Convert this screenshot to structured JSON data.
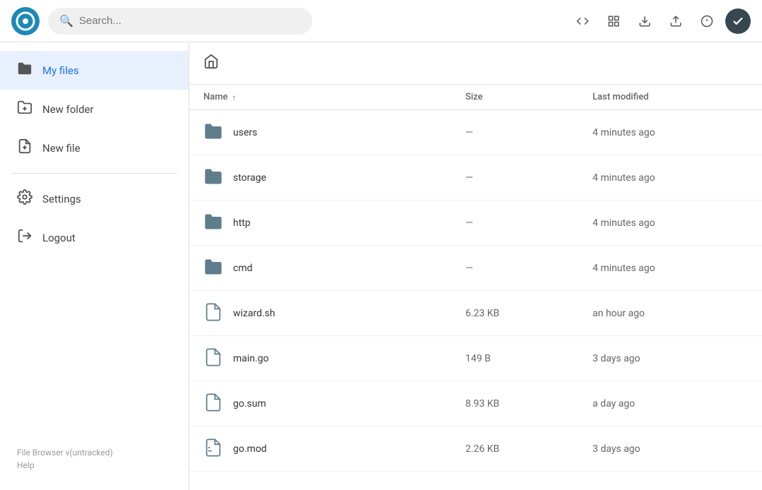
{
  "header": {
    "logo_alt": "File Browser Logo",
    "search_placeholder": "Search...",
    "actions": [
      {
        "name": "code-icon",
        "symbol": "<>",
        "label": "Code view",
        "active": false
      },
      {
        "name": "grid-icon",
        "symbol": "⊞",
        "label": "Grid view",
        "active": false
      },
      {
        "name": "download-icon",
        "symbol": "↓",
        "label": "Download",
        "active": false
      },
      {
        "name": "upload-icon",
        "symbol": "↑",
        "label": "Upload",
        "active": false
      },
      {
        "name": "info-icon",
        "symbol": "ℹ",
        "label": "Info",
        "active": false
      },
      {
        "name": "check-icon",
        "symbol": "✓",
        "label": "Select all",
        "active": true
      }
    ]
  },
  "sidebar": {
    "items": [
      {
        "id": "my-files",
        "label": "My files",
        "icon": "folder",
        "active": true
      },
      {
        "id": "new-folder",
        "label": "New folder",
        "icon": "new-folder",
        "active": false
      },
      {
        "id": "new-file",
        "label": "New file",
        "icon": "new-file",
        "active": false
      },
      {
        "id": "settings",
        "label": "Settings",
        "icon": "settings",
        "active": false
      },
      {
        "id": "logout",
        "label": "Logout",
        "icon": "logout",
        "active": false
      }
    ],
    "footer": {
      "version": "File Browser v(untracked)",
      "help": "Help"
    }
  },
  "file_list": {
    "columns": {
      "name": "Name",
      "size": "Size",
      "last_modified": "Last modified"
    },
    "rows": [
      {
        "id": "users",
        "name": "users",
        "type": "folder",
        "size": "—",
        "modified": "4 minutes ago"
      },
      {
        "id": "storage",
        "name": "storage",
        "type": "folder",
        "size": "—",
        "modified": "4 minutes ago"
      },
      {
        "id": "http",
        "name": "http",
        "type": "folder",
        "size": "—",
        "modified": "4 minutes ago"
      },
      {
        "id": "cmd",
        "name": "cmd",
        "type": "folder",
        "size": "—",
        "modified": "4 minutes ago"
      },
      {
        "id": "wizard-sh",
        "name": "wizard.sh",
        "type": "file",
        "size": "6.23 KB",
        "modified": "an hour ago"
      },
      {
        "id": "main-go",
        "name": "main.go",
        "type": "file",
        "size": "149 B",
        "modified": "3 days ago"
      },
      {
        "id": "go-sum",
        "name": "go.sum",
        "type": "file",
        "size": "8.93 KB",
        "modified": "a day ago"
      },
      {
        "id": "go-mod",
        "name": "go.mod",
        "type": "file-special",
        "size": "2.26 KB",
        "modified": "3 days ago"
      }
    ]
  },
  "colors": {
    "accent": "#1e88b8",
    "sidebar_bg": "#ffffff",
    "header_bg": "#ffffff",
    "active_nav": "#e8f0fe"
  }
}
